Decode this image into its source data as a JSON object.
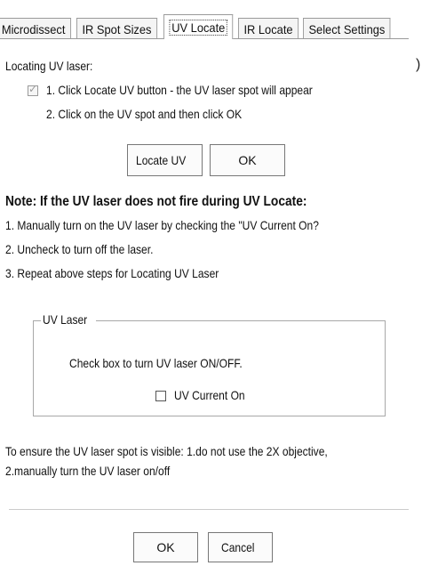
{
  "tabs": [
    {
      "label": "Microdissect"
    },
    {
      "label": "IR Spot Sizes"
    },
    {
      "label": "UV Locate"
    },
    {
      "label": "IR Locate"
    },
    {
      "label": "Select Settings"
    }
  ],
  "active_tab": "UV Locate",
  "side_mark": ")",
  "locating": {
    "heading": "Locating UV laser:",
    "step1": "1. Click Locate UV button - the UV laser spot will appear",
    "step1_checked": true,
    "step2": "2. Click on the UV spot and then click OK"
  },
  "buttons": {
    "locate_uv": "Locate UV",
    "ok_top": "OK",
    "ok_bottom": "OK",
    "cancel": "Cancel"
  },
  "note": {
    "title": "Note:  If the UV laser does not fire during UV Locate:",
    "line1": "1. Manually turn on the UV laser by checking the \"UV Current On?",
    "line2": "2. Uncheck to turn off the laser.",
    "line3": "3. Repeat above steps for Locating UV Laser"
  },
  "uv_laser_group": {
    "legend": "UV Laser",
    "instruction": "Check box to turn UV laser ON/OFF.",
    "checkbox_label": "UV Current On",
    "checkbox_checked": false
  },
  "footer_note": {
    "line1": "To ensure the UV laser spot is visible: 1.do not use the 2X objective,",
    "line2": "2.manually turn the UV laser on/off"
  }
}
